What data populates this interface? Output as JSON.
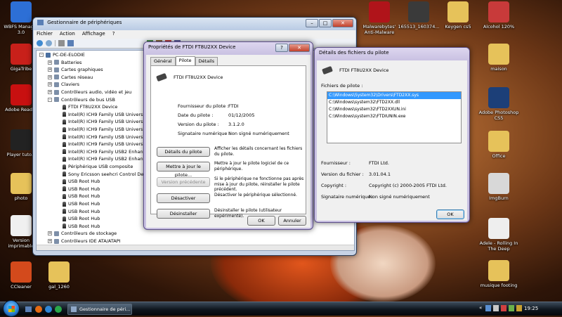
{
  "desktop": {
    "icons_left": [
      {
        "label": "WBFS Manager 3.0",
        "icon": "wbfs-icon",
        "color": "#2d6fd6"
      },
      {
        "label": "GigaTribe",
        "icon": "gigatribe-icon",
        "color": "#c8201a"
      },
      {
        "label": "Adobe Reader",
        "icon": "pdf-icon",
        "color": "#c81010"
      },
      {
        "label": "Player tuto.c",
        "icon": "player-icon",
        "color": "#222222"
      },
      {
        "label": "photo",
        "icon": "folder-icon",
        "color": "#e6c25a"
      },
      {
        "label": "Version imprimable",
        "icon": "document-icon",
        "color": "#f0f0f0"
      },
      {
        "label": "CCleaner",
        "icon": "ccleaner-icon",
        "color": "#d34a1c"
      }
    ],
    "icons_right": [
      {
        "label": "Malwarebytes' Anti-Malware",
        "icon": "malwarebytes-icon",
        "color": "#b0141a"
      },
      {
        "label": "165513_160374...",
        "icon": "image-file-icon",
        "color": "#3a3a3a"
      },
      {
        "label": "Keygen cs5",
        "icon": "folder-icon",
        "color": "#e6c25a"
      },
      {
        "label": "Alcohol 120%",
        "icon": "alcohol-icon",
        "color": "#c83a3a"
      },
      {
        "label": "maison",
        "icon": "folder-icon",
        "color": "#e6c25a"
      },
      {
        "label": "Adobe Photoshop CS5",
        "icon": "photoshop-icon",
        "color": "#1c3f78"
      },
      {
        "label": "Office",
        "icon": "folder-icon",
        "color": "#e6c25a"
      },
      {
        "label": "ImgBurn",
        "icon": "imgburn-icon",
        "color": "#d8d8d8"
      },
      {
        "label": "Adele - Rolling In The Deep",
        "icon": "mp3-icon",
        "color": "#eeeeee"
      },
      {
        "label": "musique footing",
        "icon": "folder-icon",
        "color": "#e6c25a"
      }
    ],
    "icon_gal": {
      "label": "gal_1260",
      "icon": "folder-icon"
    }
  },
  "device_manager": {
    "title": "Gestionnaire de périphériques",
    "menu": [
      "Fichier",
      "Action",
      "Affichage",
      "?"
    ],
    "tree": [
      {
        "label": "PC-DE-ELODIE",
        "level": 0,
        "exp": "-"
      },
      {
        "label": "Batteries",
        "level": 1,
        "exp": "+"
      },
      {
        "label": "Cartes graphiques",
        "level": 1,
        "exp": "+"
      },
      {
        "label": "Cartes réseau",
        "level": 1,
        "exp": "+"
      },
      {
        "label": "Claviers",
        "level": 1,
        "exp": "+"
      },
      {
        "label": "Contrôleurs audio, vidéo et jeu",
        "level": 1,
        "exp": "+"
      },
      {
        "label": "Contrôleurs de bus USB",
        "level": 1,
        "exp": "-"
      },
      {
        "label": "FTDI FT8U2XX Device",
        "level": 2,
        "usb": true
      },
      {
        "label": "Intel(R) ICH9 Family USB Universal H",
        "level": 2,
        "usb": true
      },
      {
        "label": "Intel(R) ICH9 Family USB Universal H",
        "level": 2,
        "usb": true
      },
      {
        "label": "Intel(R) ICH9 Family USB Universal H",
        "level": 2,
        "usb": true
      },
      {
        "label": "Intel(R) ICH9 Family USB Universal H",
        "level": 2,
        "usb": true
      },
      {
        "label": "Intel(R) ICH9 Family USB Universal H",
        "level": 2,
        "usb": true
      },
      {
        "label": "Intel(R) ICH9 Family USB2 Enhanced",
        "level": 2,
        "usb": true
      },
      {
        "label": "Intel(R) ICH9 Family USB2 Enhanced",
        "level": 2,
        "usb": true
      },
      {
        "label": "Périphérique USB composite",
        "level": 2,
        "usb": true
      },
      {
        "label": "Sony Ericsson seehcri Control Devic",
        "level": 2,
        "usb": true
      },
      {
        "label": "USB Root Hub",
        "level": 2,
        "usb": true
      },
      {
        "label": "USB Root Hub",
        "level": 2,
        "usb": true
      },
      {
        "label": "USB Root Hub",
        "level": 2,
        "usb": true
      },
      {
        "label": "USB Root Hub",
        "level": 2,
        "usb": true
      },
      {
        "label": "USB Root Hub",
        "level": 2,
        "usb": true
      },
      {
        "label": "USB Root Hub",
        "level": 2,
        "usb": true
      },
      {
        "label": "USB Root Hub",
        "level": 2,
        "usb": true
      },
      {
        "label": "Contrôleurs de stockage",
        "level": 1,
        "exp": "+"
      },
      {
        "label": "Contrôleurs IDE ATA/ATAPI",
        "level": 1,
        "exp": "+"
      }
    ]
  },
  "properties": {
    "title": "Propriétés de FTDI FT8U2XX Device",
    "tabs": [
      "Général",
      "Pilote",
      "Détails"
    ],
    "active_tab": "Pilote",
    "device_name": "FTDI FT8U2XX Device",
    "fields": [
      {
        "label": "Fournisseur du pilote :",
        "value": "FTDI"
      },
      {
        "label": "Date du pilote :",
        "value": "01/12/2005"
      },
      {
        "label": "Version du pilote :",
        "value": "3.1.2.0"
      },
      {
        "label": "Signataire numérique :",
        "value": "Non signé numériquement"
      }
    ],
    "actions": [
      {
        "button": "Détails du pilote",
        "desc": "Afficher les détails concernant les fichiers du pilote.",
        "disabled": false
      },
      {
        "button": "Mettre à jour le pilote...",
        "desc": "Mettre à jour le pilote logiciel de ce périphérique.",
        "disabled": false
      },
      {
        "button": "Version précédente",
        "desc": "Si le périphérique ne fonctionne pas après mise à jour du pilote, réinstaller le pilote précédent.",
        "disabled": true
      },
      {
        "button": "Désactiver",
        "desc": "Désactiver le périphérique sélectionné.",
        "disabled": false
      },
      {
        "button": "Désinstaller",
        "desc": "Désinstaller le pilote (utilisateur expérimenté).",
        "disabled": false
      }
    ],
    "ok": "OK",
    "cancel": "Annuler"
  },
  "file_details": {
    "title": "Détails des fichiers du pilote",
    "device_name": "FTDI FT8U2XX Device",
    "files_label": "Fichiers de pilote :",
    "files": [
      "C:\\Windows\\System32\\Drivers\\FTD2XX.sys",
      "C:\\Windows\\system32\\FTD2XX.dll",
      "C:\\Windows\\system32\\FTD2XXUN.ini",
      "C:\\Windows\\system32\\FTDIUNIN.exe"
    ],
    "selected_file_index": 0,
    "fields": [
      {
        "label": "Fournisseur :",
        "value": "FTDI Ltd."
      },
      {
        "label": "Version du fichier :",
        "value": "3.01.04.1"
      },
      {
        "label": "Copyright :",
        "value": "Copyright (c) 2000-2005 FTDI Ltd."
      },
      {
        "label": "Signataire numérique :",
        "value": "Non signé numériquement"
      }
    ],
    "ok": "OK"
  },
  "taskbar": {
    "task_label": "Gestionnaire de péri...",
    "clock": "19:25"
  },
  "colors": {
    "title_glass": "#b9cbe4",
    "selection": "#3399ff",
    "start_orb": "#2a7fd4"
  }
}
